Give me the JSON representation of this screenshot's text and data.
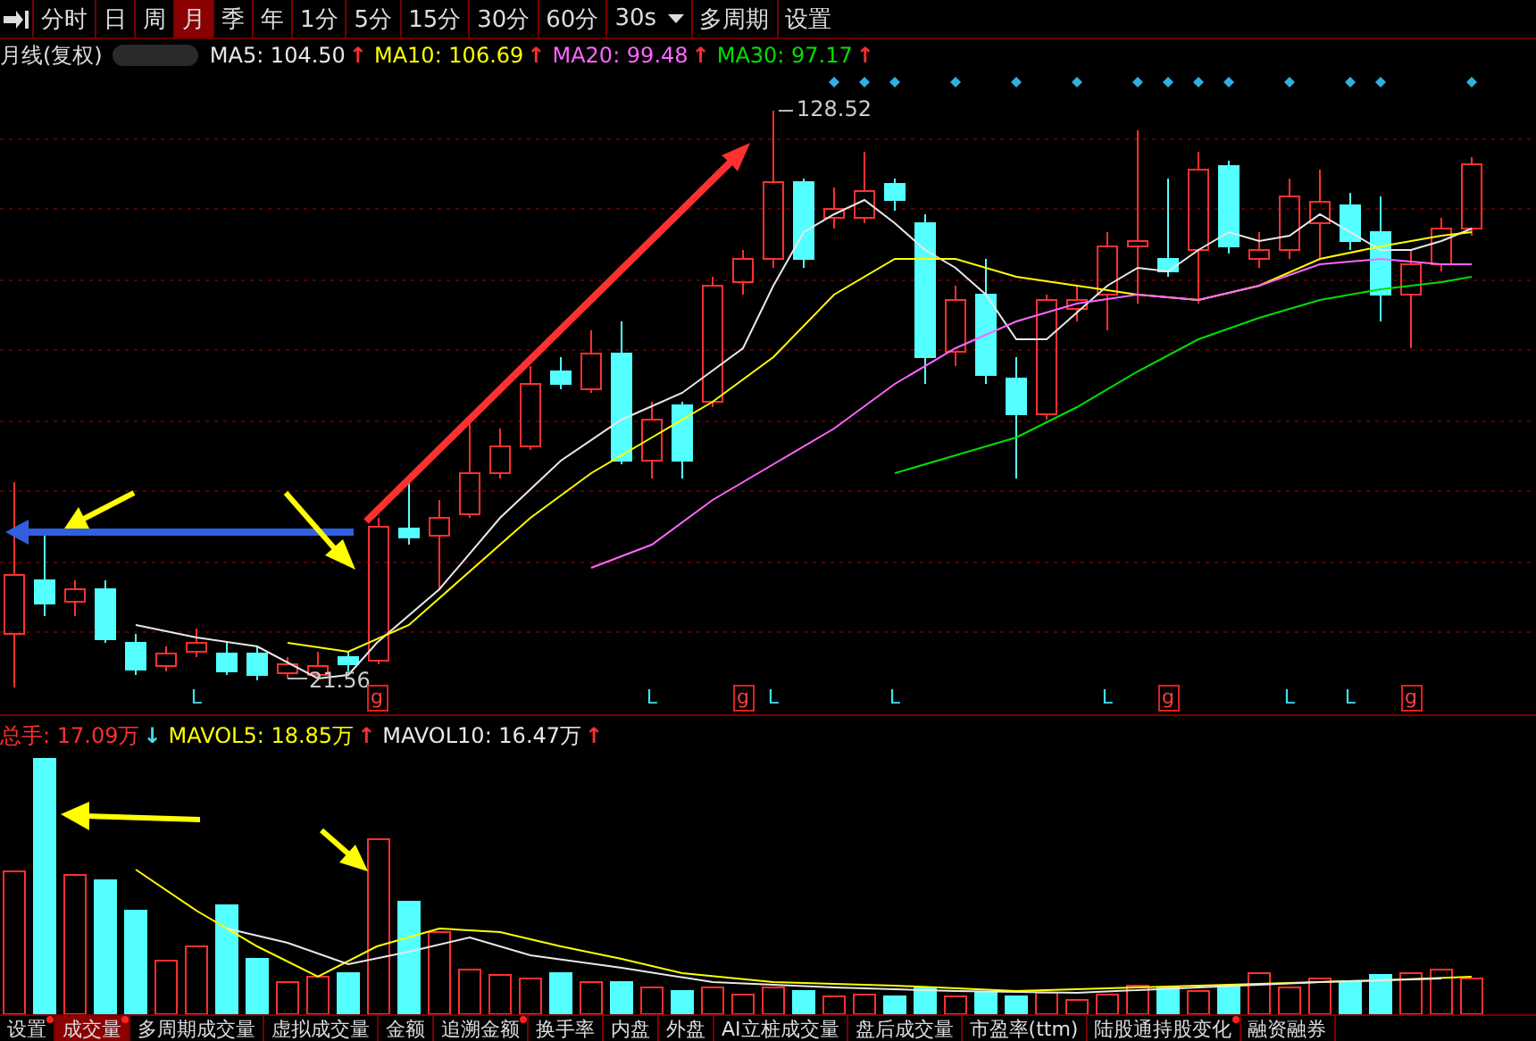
{
  "toolbar": [
    {
      "label": "分时",
      "kind": "tab",
      "selected": false
    },
    {
      "label": "日",
      "kind": "tab",
      "selected": false
    },
    {
      "label": "周",
      "kind": "tab",
      "selected": false
    },
    {
      "label": "月",
      "kind": "tab",
      "selected": true
    },
    {
      "label": "季",
      "kind": "tab",
      "selected": false
    },
    {
      "label": "年",
      "kind": "tab",
      "selected": false
    },
    {
      "label": "1分",
      "kind": "tab",
      "selected": false
    },
    {
      "label": "5分",
      "kind": "tab",
      "selected": false
    },
    {
      "label": "15分",
      "kind": "tab",
      "selected": false
    },
    {
      "label": "30分",
      "kind": "tab",
      "selected": false
    },
    {
      "label": "60分",
      "kind": "tab",
      "selected": false
    },
    {
      "label": "30s",
      "kind": "dropdown",
      "selected": false
    },
    {
      "label": "多周期",
      "kind": "button",
      "selected": false
    },
    {
      "label": "设置",
      "kind": "button",
      "selected": false
    }
  ],
  "legend": {
    "title": "月线(复权)",
    "items": [
      {
        "label": "MA5: 104.50",
        "color": "#e8e8e8",
        "arrow": {
          "symbol": "↑",
          "color": "#ff3030"
        }
      },
      {
        "label": "MA10: 106.69",
        "color": "#ffff00",
        "arrow": {
          "symbol": "↑",
          "color": "#ff3030"
        }
      },
      {
        "label": "MA20: 99.48",
        "color": "#ff66ff",
        "arrow": {
          "symbol": "↑",
          "color": "#ff3030"
        }
      },
      {
        "label": "MA30: 97.17",
        "color": "#00e000",
        "arrow": {
          "symbol": "↑",
          "color": "#ff3030"
        }
      }
    ]
  },
  "price_chart": {
    "high_label": "128.52",
    "low_label": "21.56",
    "markers": [
      {
        "label": "L",
        "kind": "plain"
      },
      {
        "label": "g",
        "kind": "boxed"
      },
      {
        "label": "L",
        "kind": "plain"
      },
      {
        "label": "g",
        "kind": "boxed"
      },
      {
        "label": "L",
        "kind": "plain"
      },
      {
        "label": "L",
        "kind": "plain"
      },
      {
        "label": "L",
        "kind": "plain"
      },
      {
        "label": "g",
        "kind": "boxed"
      },
      {
        "label": "L",
        "kind": "plain"
      },
      {
        "label": "L",
        "kind": "plain"
      },
      {
        "label": "g",
        "kind": "boxed"
      }
    ]
  },
  "volume_legend": {
    "items": [
      {
        "label": "总手: 17.09万",
        "color": "#ff3030",
        "arrow": {
          "symbol": "↓",
          "color": "#40e0f0"
        }
      },
      {
        "label": "MAVOL5: 18.85万",
        "color": "#ffff00",
        "arrow": {
          "symbol": "↑",
          "color": "#ff3030"
        }
      },
      {
        "label": "MAVOL10: 16.47万",
        "color": "#e8e8e8",
        "arrow": {
          "symbol": "↑",
          "color": "#ff3030"
        }
      }
    ]
  },
  "bottom_tabs": [
    {
      "label": "设置",
      "selected": false,
      "flagged": true
    },
    {
      "label": "成交量",
      "selected": true,
      "flagged": true
    },
    {
      "label": "多周期成交量",
      "selected": false,
      "flagged": false
    },
    {
      "label": "虚拟成交量",
      "selected": false,
      "flagged": false
    },
    {
      "label": "金额",
      "selected": false,
      "flagged": false
    },
    {
      "label": "追溯金额",
      "selected": false,
      "flagged": true
    },
    {
      "label": "换手率",
      "selected": false,
      "flagged": false
    },
    {
      "label": "内盘",
      "selected": false,
      "flagged": false
    },
    {
      "label": "外盘",
      "selected": false,
      "flagged": false
    },
    {
      "label": "AI立桩成交量",
      "selected": false,
      "flagged": false
    },
    {
      "label": "盘后成交量",
      "selected": false,
      "flagged": false
    },
    {
      "label": "市盈率(ttm)",
      "selected": false,
      "flagged": false
    },
    {
      "label": "陆股通持股变化",
      "selected": false,
      "flagged": true
    },
    {
      "label": "融资融券",
      "selected": false,
      "flagged": false
    }
  ]
}
